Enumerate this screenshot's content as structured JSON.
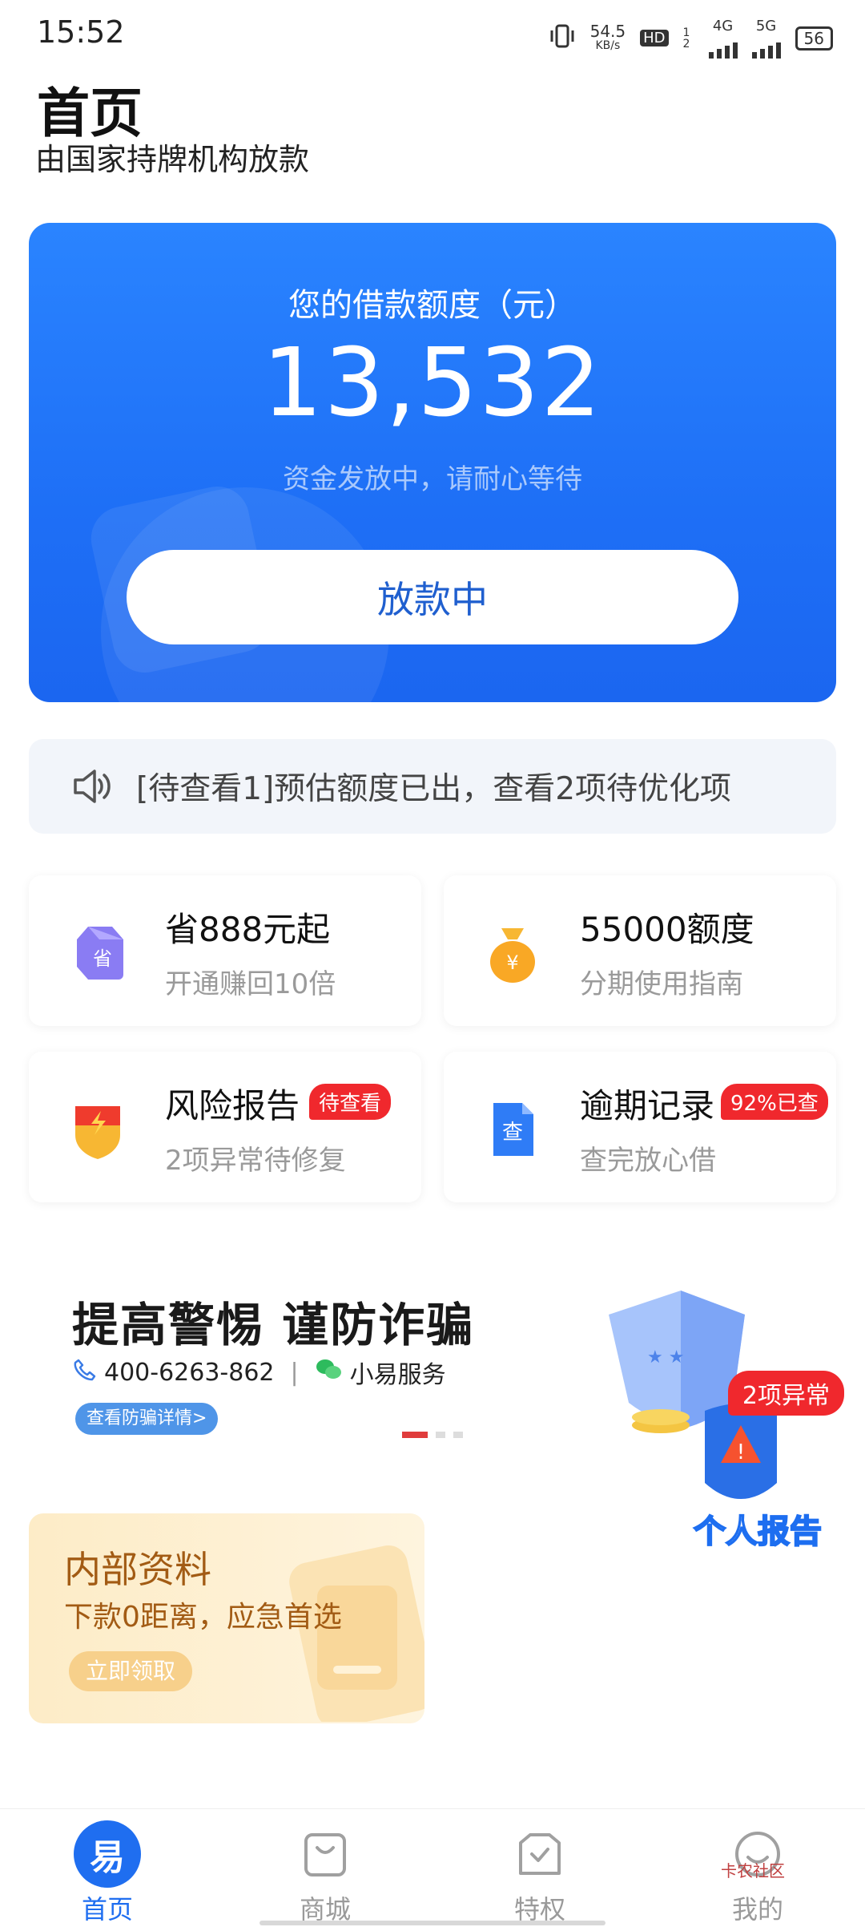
{
  "status": {
    "time": "15:52",
    "net_speed": "54.5",
    "net_unit": "KB/s",
    "hd": "HD",
    "sim": "1 2",
    "net1": "4G",
    "net2": "5G",
    "battery": "56"
  },
  "header": {
    "title": "首页",
    "subtitle": "由国家持牌机构放款"
  },
  "hero": {
    "label": "您的借款额度（元）",
    "amount": "13,532",
    "note": "资金发放中，请耐心等待",
    "button": "放款中"
  },
  "notice": {
    "text": "[待查看1]预估额度已出，查看2项待优化项"
  },
  "cards": [
    {
      "title": "省888元起",
      "sub": "开通赚回10倍",
      "icon": "tag-icon"
    },
    {
      "title": "55000额度",
      "sub": "分期使用指南",
      "icon": "money-bag-icon"
    },
    {
      "title": "风险报告",
      "sub": "2项异常待修复",
      "badge": "待查看",
      "icon": "shield-icon"
    },
    {
      "title": "逾期记录",
      "sub": "查完放心借",
      "badge": "92%已查",
      "icon": "document-icon",
      "icon_text": "查"
    }
  ],
  "fraud": {
    "title": "提高警惕 谨防诈骗",
    "phone": "400-6263-862",
    "service": "小易服务",
    "button": "查看防骗详情>"
  },
  "report_float": {
    "badge": "2项异常",
    "label": "个人报告"
  },
  "inner_card": {
    "title": "内部资料",
    "sub": "下款0距离，应急首选",
    "button": "立即领取"
  },
  "nav": [
    {
      "label": "首页",
      "icon_text": "易",
      "active": true
    },
    {
      "label": "商城"
    },
    {
      "label": "特权"
    },
    {
      "label": "我的"
    }
  ],
  "watermark": "卡农社区",
  "colors": {
    "primary": "#1f6ef0",
    "danger": "#f0282d",
    "gold": "#a25b14"
  }
}
